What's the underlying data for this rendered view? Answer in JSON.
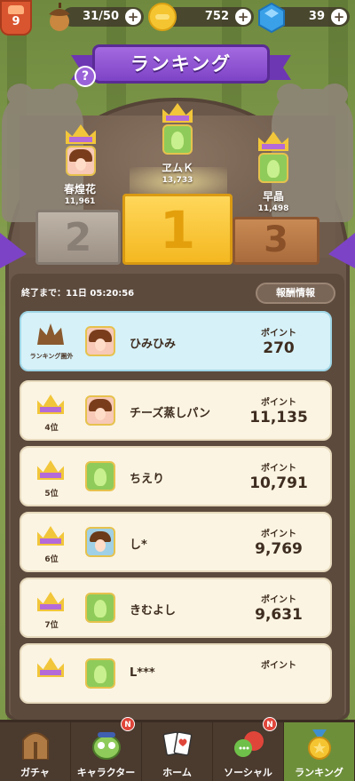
{
  "player": {
    "level": "9"
  },
  "resources": {
    "acorns": "31/50",
    "coins": "752",
    "gems": "39"
  },
  "banner": {
    "title": "ランキング",
    "help": "?"
  },
  "top3": [
    {
      "rank": "2",
      "name": "春煌花",
      "score": "11,961",
      "avatar": "girl"
    },
    {
      "rank": "1",
      "name": "ヱムＫ",
      "score": "13,733",
      "avatar": "blob"
    },
    {
      "rank": "3",
      "name": "早晶",
      "score": "11,498",
      "avatar": "blob"
    }
  ],
  "panel": {
    "timer": "終了まで：11日 05:20:56",
    "reward_button": "報酬情報",
    "points_label": "ポイント"
  },
  "rows": [
    {
      "rank": "ランキング圏外",
      "name": "ひみひみ",
      "points": "270",
      "avatar": "girl",
      "me": true
    },
    {
      "rank": "4位",
      "name": "チーズ蒸しパン",
      "points": "11,135",
      "avatar": "girl",
      "me": false
    },
    {
      "rank": "5位",
      "name": "ちえり",
      "points": "10,791",
      "avatar": "blob",
      "me": false
    },
    {
      "rank": "6位",
      "name": "し*",
      "points": "9,769",
      "avatar": "boy",
      "me": false
    },
    {
      "rank": "7位",
      "name": "きむよし",
      "points": "9,631",
      "avatar": "blob",
      "me": false
    },
    {
      "rank": "",
      "name": "L***",
      "points": "",
      "avatar": "frog",
      "me": false
    }
  ],
  "nav": [
    {
      "label": "ガチャ",
      "icon": "door-icon",
      "badge": ""
    },
    {
      "label": "キャラクター",
      "icon": "character-icon",
      "badge": "N"
    },
    {
      "label": "ホーム",
      "icon": "cards-icon",
      "badge": ""
    },
    {
      "label": "ソーシャル",
      "icon": "chat-icon",
      "badge": "N"
    },
    {
      "label": "ランキング",
      "icon": "medal-icon",
      "badge": "",
      "active": true
    }
  ],
  "colors": {
    "banner": "#7d43c6",
    "gold": "#f4b821",
    "highlight_row": "#d6f1f8",
    "nav_active": "#6e8f3a"
  }
}
